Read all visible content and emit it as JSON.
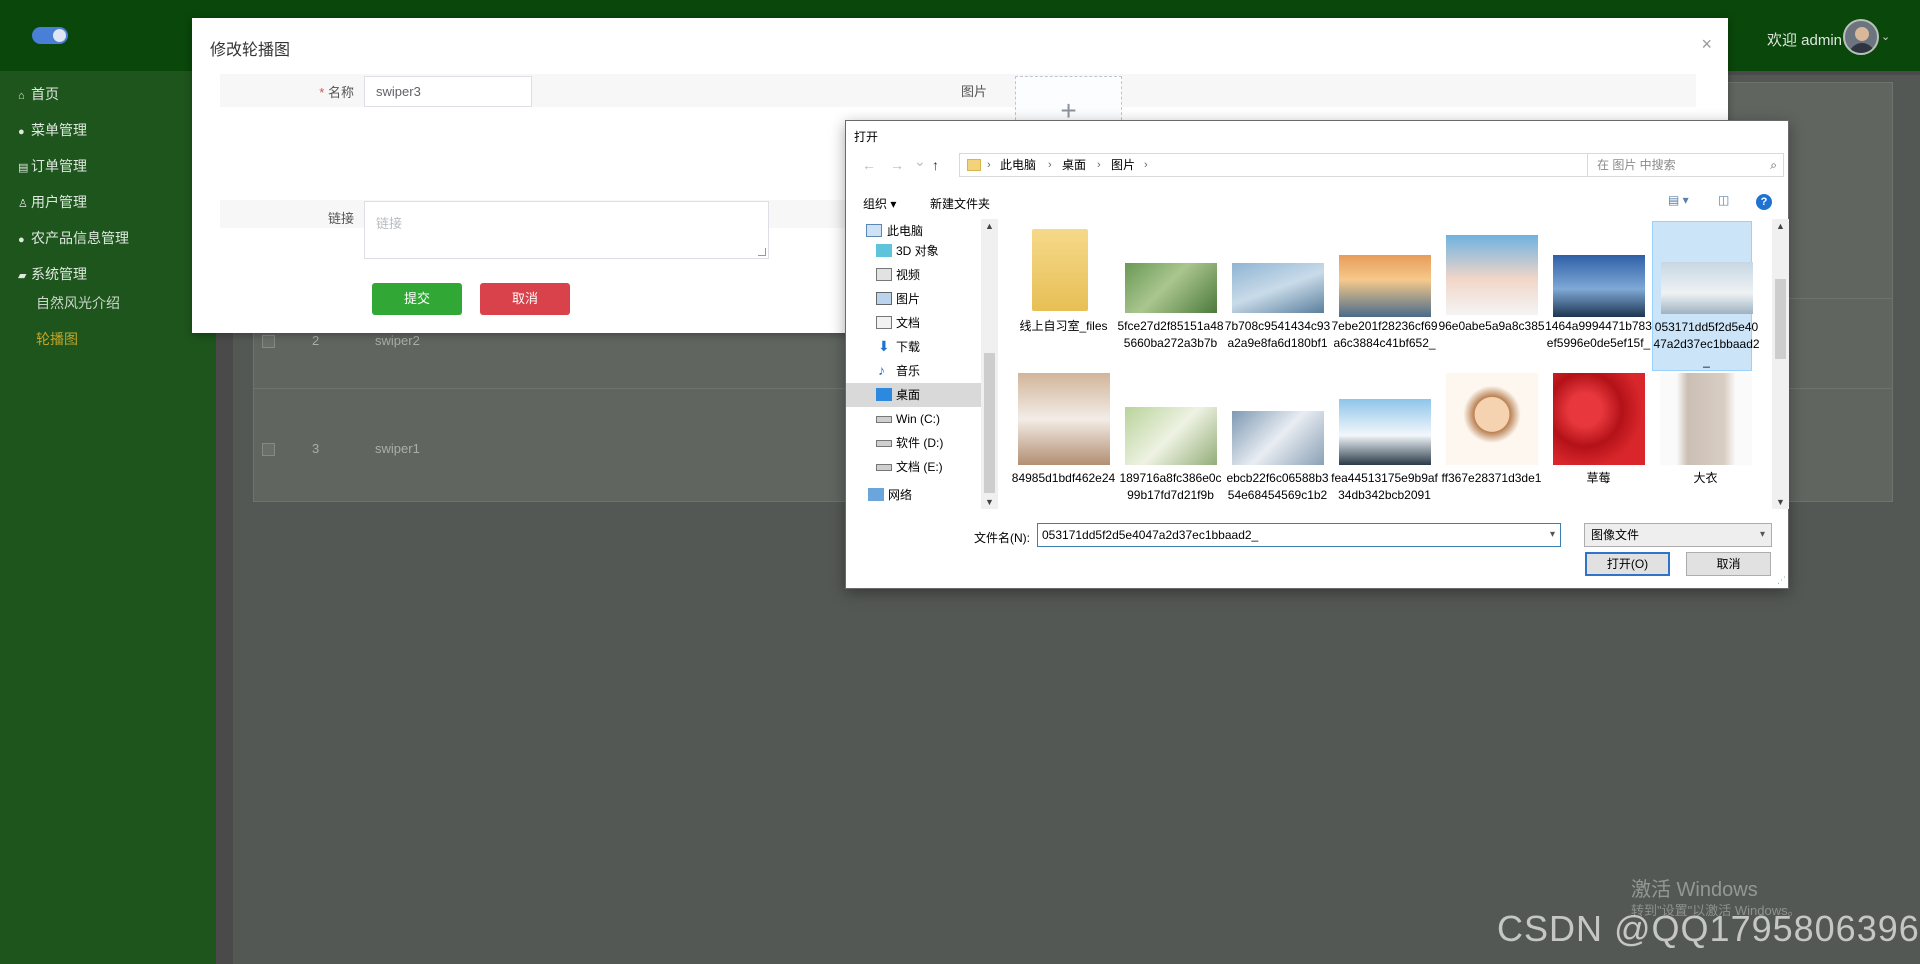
{
  "header": {
    "welcome": "欢迎 admin"
  },
  "sidebar": {
    "items": [
      {
        "label": "首页",
        "icon": "home-icon"
      },
      {
        "label": "菜单管理",
        "icon": "circle-icon"
      },
      {
        "label": "订单管理",
        "icon": "list-icon"
      },
      {
        "label": "用户管理",
        "icon": "user-icon"
      },
      {
        "label": "农产品信息管理",
        "icon": "circle-icon"
      },
      {
        "label": "系统管理",
        "icon": "folder-icon"
      }
    ],
    "sub_items": [
      {
        "label": "自然风光介绍",
        "active": false
      },
      {
        "label": "轮播图",
        "active": true
      }
    ]
  },
  "table": {
    "rows": [
      {
        "index": "2",
        "name": "swiper2"
      },
      {
        "index": "3",
        "name": "swiper1"
      }
    ]
  },
  "modal": {
    "title": "修改轮播图",
    "close": "×",
    "name_required_mark": "*",
    "name_label": "名称",
    "name_value": "swiper3",
    "image_label": "图片",
    "upload_plus": "+",
    "link_label": "链接",
    "link_placeholder": "链接",
    "submit_label": "提交",
    "cancel_label": "取消"
  },
  "file_dialog": {
    "title": "打开",
    "nav": {
      "back": "←",
      "forward": "→",
      "recent": "⌄",
      "up": "↑"
    },
    "breadcrumb": [
      "此电脑",
      "桌面",
      "图片"
    ],
    "breadcrumb_sep": "›",
    "refresh": "↻",
    "search_placeholder": "在 图片 中搜索",
    "organize_label": "组织 ▾",
    "new_folder_label": "新建文件夹",
    "help": "?",
    "tree": [
      {
        "label": "此电脑",
        "icon": "computer-icon",
        "selected": false
      },
      {
        "label": "3D 对象",
        "icon": "cube-icon",
        "selected": false
      },
      {
        "label": "视频",
        "icon": "video-icon",
        "selected": false
      },
      {
        "label": "图片",
        "icon": "pictures-icon",
        "selected": false
      },
      {
        "label": "文档",
        "icon": "documents-icon",
        "selected": false
      },
      {
        "label": "下载",
        "icon": "download-icon",
        "selected": false
      },
      {
        "label": "音乐",
        "icon": "music-icon",
        "selected": false
      },
      {
        "label": "桌面",
        "icon": "desktop-icon",
        "selected": true
      },
      {
        "label": "Win (C:)",
        "icon": "drive-icon",
        "selected": false
      },
      {
        "label": "软件 (D:)",
        "icon": "drive-icon",
        "selected": false
      },
      {
        "label": "文档 (E:)",
        "icon": "drive-icon",
        "selected": false
      },
      {
        "label": "网络",
        "icon": "network-icon",
        "selected": false
      }
    ],
    "files": [
      {
        "name": "线上自习室_files",
        "kind": "folder"
      },
      {
        "name": "5fce27d2f85151a485660ba272a3b7b",
        "kind": "cat"
      },
      {
        "name": "7b708c9541434c93a2a9e8fa6d180bf1",
        "kind": "bridge"
      },
      {
        "name": "7ebe201f28236cf69a6c3884c41bf652_",
        "kind": "sunset"
      },
      {
        "name": "96e0abe5a9a8c385",
        "kind": "portrait"
      },
      {
        "name": "1464a9994471b783ef5996e0de5ef15f_",
        "kind": "lake"
      },
      {
        "name": "053171dd5f2d5e4047a2d37ec1bbaad2_",
        "kind": "mist",
        "selected": true
      },
      {
        "name": "84985d1bdf462e24",
        "kind": "portrait2"
      },
      {
        "name": "189716a8fc386e0c99b17fd7d21f9b",
        "kind": "kitten"
      },
      {
        "name": "ebcb22f6c06588b354e68454569c1b2",
        "kind": "whitecat"
      },
      {
        "name": "fea44513175e9b9af34db342bcb2091",
        "kind": "camera"
      },
      {
        "name": "ff367e28371d3de1",
        "kind": "cartoon"
      },
      {
        "name": "草莓",
        "kind": "strawberry"
      },
      {
        "name": "大衣",
        "kind": "coat"
      }
    ],
    "filename_label": "文件名(N):",
    "filename_value": "053171dd5f2d5e4047a2d37ec1bbaad2_",
    "filetype_value": "图像文件",
    "open_label": "打开(O)",
    "cancel_label": "取消"
  },
  "watermarks": {
    "windows_line1": "激活 Windows",
    "windows_line2": "转到\"设置\"以激活 Windows。",
    "csdn": "CSDN @QQ1795806396"
  },
  "colors": {
    "header_bg": "#0a470a",
    "sidebar_bg": "#1d551d",
    "active_sub": "#c3a529",
    "submit": "#31a836",
    "cancel": "#d9424b",
    "dialog_accent": "#1e73d0"
  }
}
